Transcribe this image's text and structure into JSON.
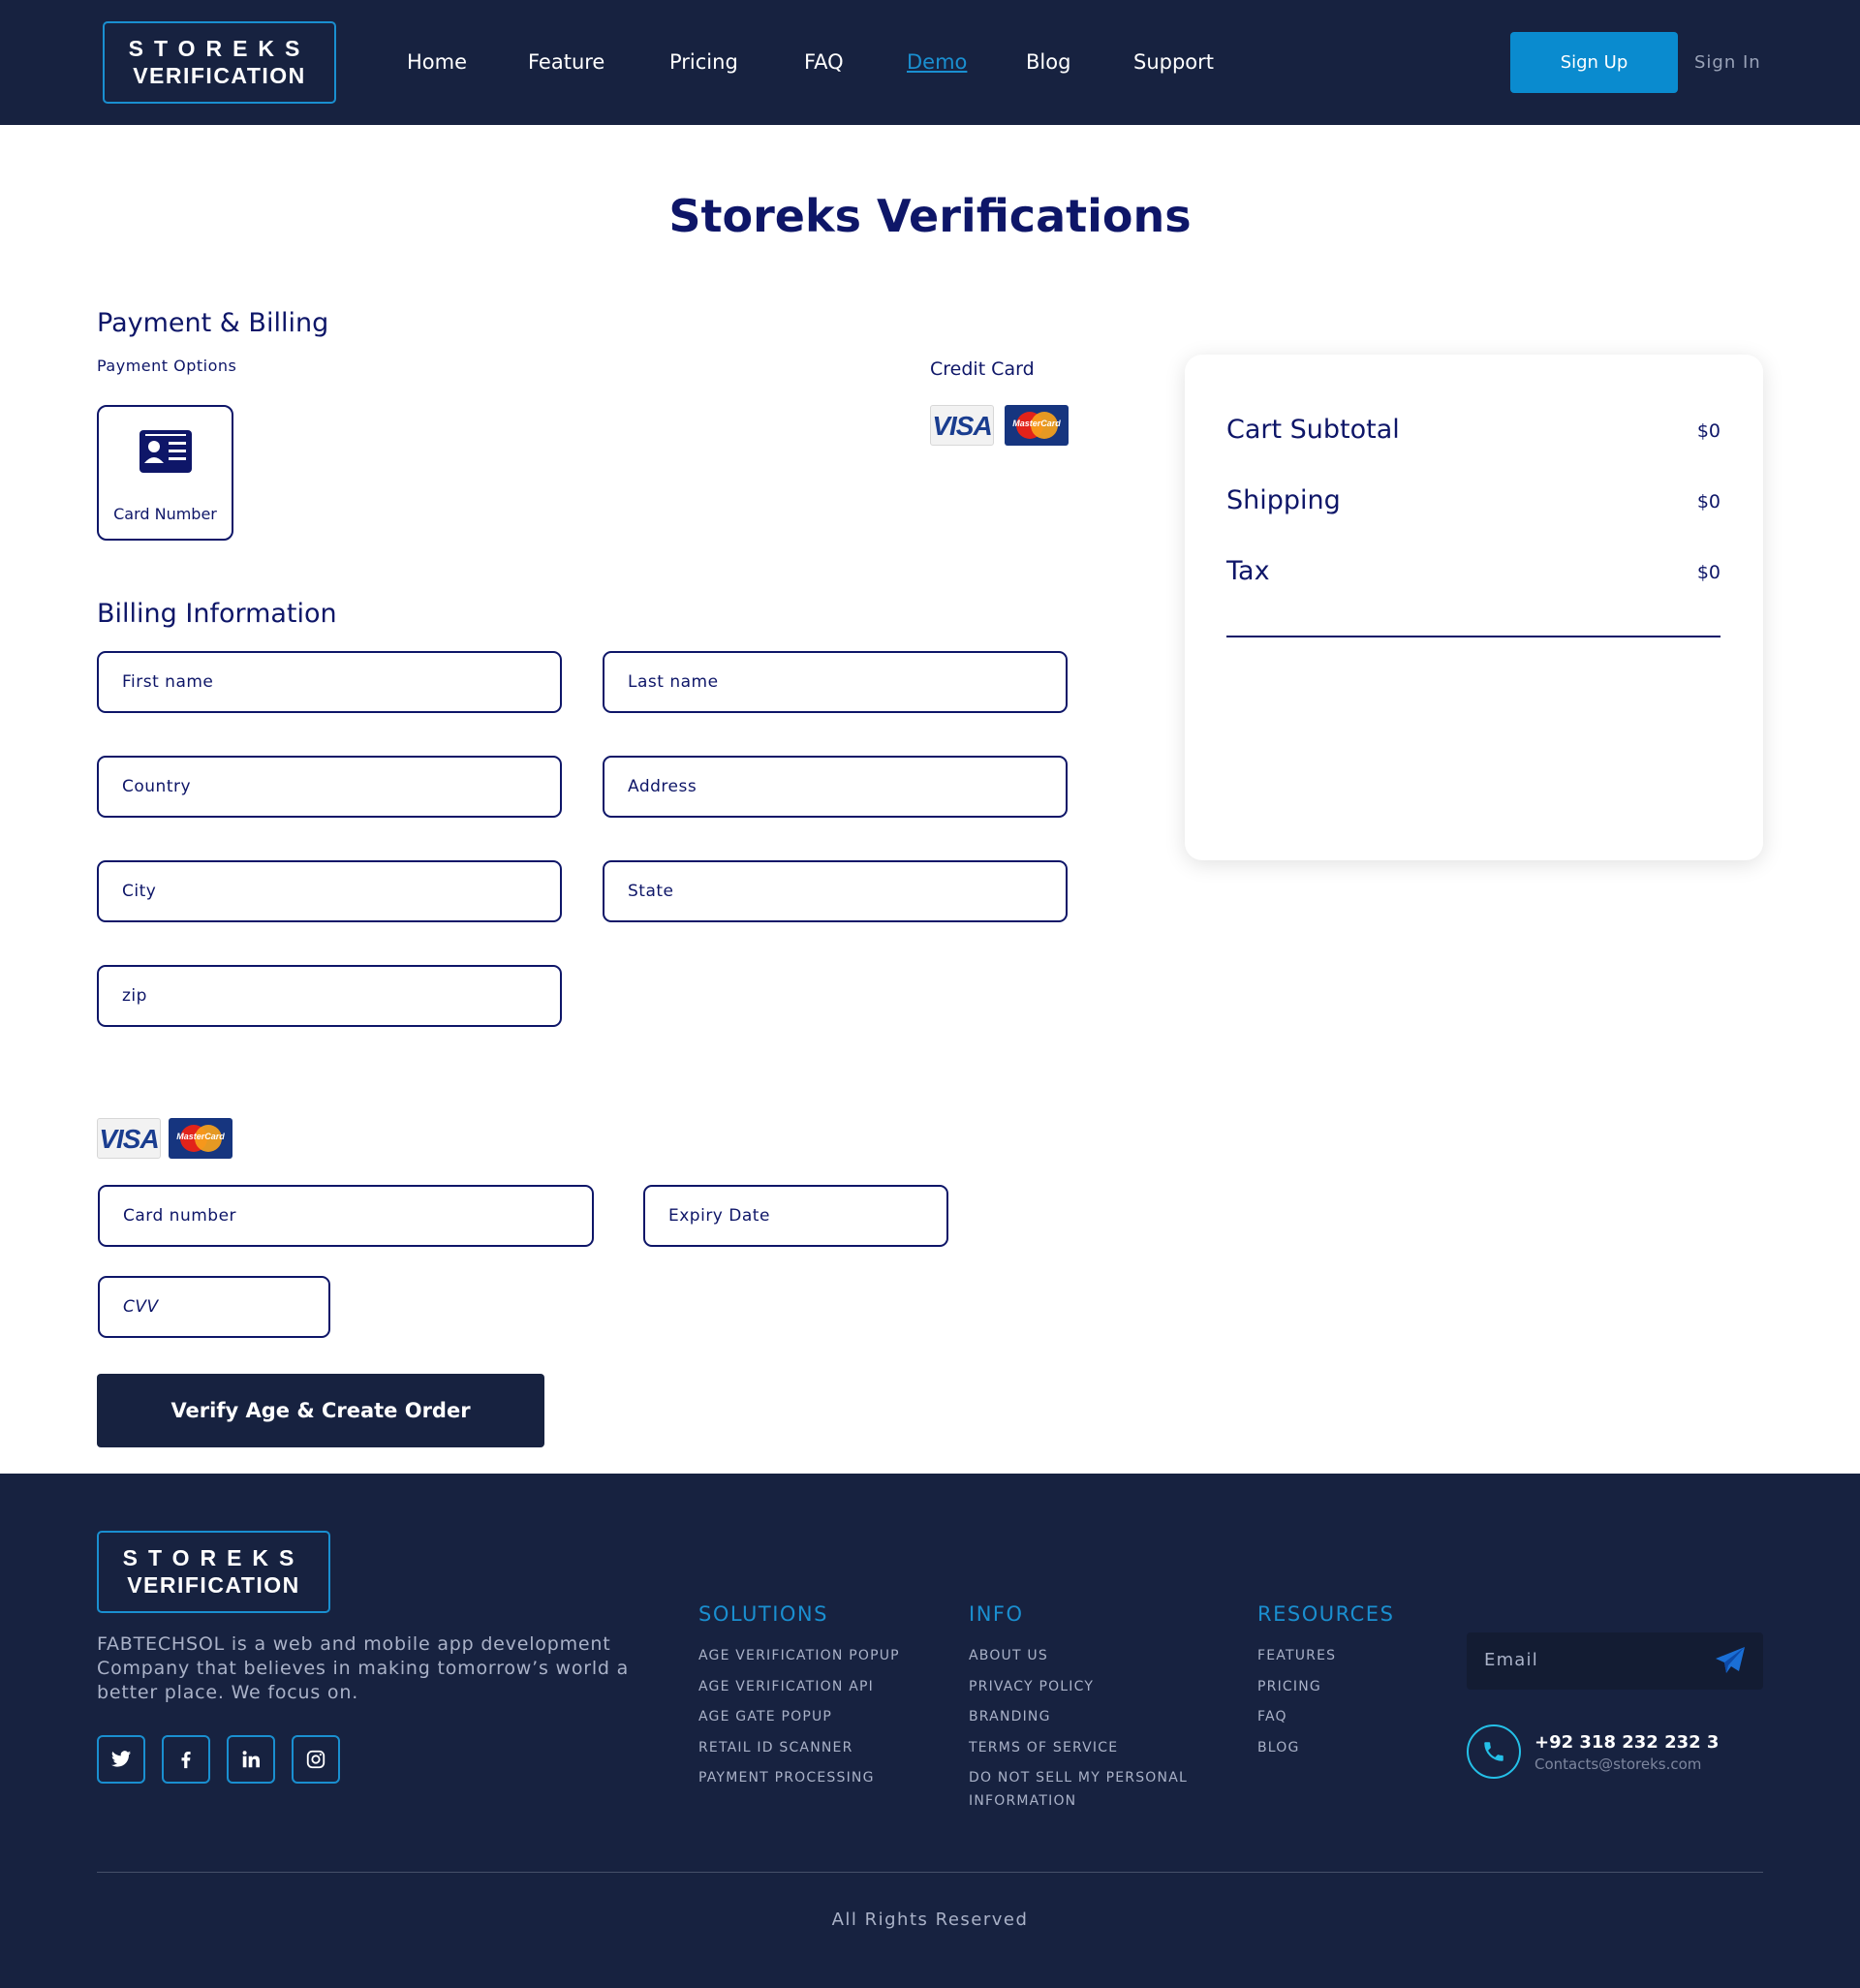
{
  "header": {
    "logo_line1": "STOREKS",
    "logo_line2": "VERIFICATION",
    "nav": [
      "Home",
      "Feature",
      "Pricing",
      "FAQ",
      "Demo",
      "Blog",
      "Support"
    ],
    "active_nav": "Demo",
    "signup_label": "Sign Up",
    "signin_label": "Sign In"
  },
  "main": {
    "title": "Storeks Verifications",
    "payment_heading": "Payment & Billing",
    "payment_options_label": "Payment Options",
    "credit_card_label": "Credit Card",
    "option_card": {
      "label": "Card Number",
      "icon": "id-card-icon"
    },
    "billing_heading": "Billing Information",
    "billing_fields": {
      "first_name": "First name",
      "last_name": "Last name",
      "country": "Country",
      "address": "Address",
      "city": "City",
      "state": "State",
      "zip": "zip"
    },
    "card_fields": {
      "card_number": "Card number",
      "expiry": "Expiry Date",
      "cvv": "CVV"
    },
    "card_brands": {
      "visa": "VISA",
      "mastercard": "MasterCard"
    },
    "submit_label": "Verify Age & Create Order"
  },
  "summary": {
    "rows": [
      {
        "label": "Cart Subtotal",
        "value": "$0"
      },
      {
        "label": "Shipping",
        "value": "$0"
      },
      {
        "label": "Tax",
        "value": "$0"
      }
    ]
  },
  "footer": {
    "logo_line1": "STOREKS",
    "logo_line2": "VERIFICATION",
    "description": "FABTECHSOL is a web and mobile app development Company that believes in making tomorrow’s world a better place. We focus on.",
    "social": [
      "twitter-icon",
      "facebook-icon",
      "linkedin-icon",
      "instagram-icon"
    ],
    "columns": [
      {
        "title": "SOLUTIONS",
        "links": [
          "AGE VERIFICATION POPUP",
          "AGE VERIFICATION API",
          "AGE GATE POPUP",
          "RETAIL ID SCANNER",
          "PAYMENT PROCESSING"
        ]
      },
      {
        "title": "INFO",
        "links": [
          "ABOUT US",
          "PRIVACY POLICY",
          "BRANDING",
          "TERMS OF SERVICE",
          "DO NOT SELL MY PERSONAL INFORMATION"
        ]
      },
      {
        "title": "RESOURCES",
        "links": [
          "FEATURES",
          "PRICING",
          "FAQ",
          "BLOG"
        ]
      }
    ],
    "email_placeholder": "Email",
    "phone": "+92 318 232 232 3",
    "contact_email": "Contacts@storeks.com",
    "copyright": "All Rights Reserved"
  },
  "colors": {
    "navy": "#172240",
    "accent_blue": "#1a8fd0",
    "text_navy": "#0e1668",
    "signup_bg": "#0a8bcf"
  }
}
